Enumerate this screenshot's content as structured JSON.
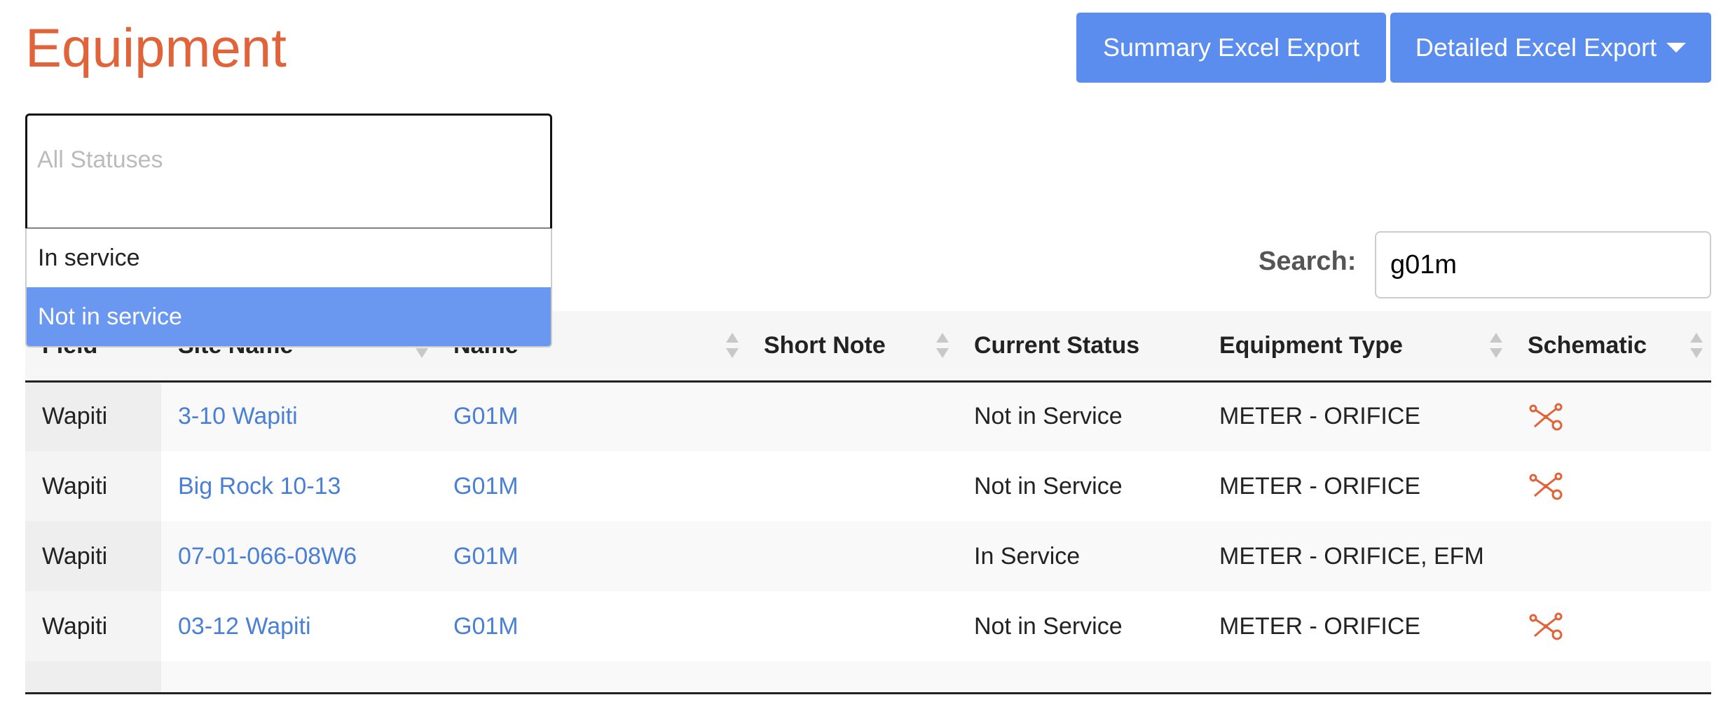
{
  "header": {
    "title": "Equipment",
    "summary_export_label": "Summary Excel Export",
    "detailed_export_label": "Detailed Excel Export"
  },
  "status_filter": {
    "placeholder": "All Statuses",
    "options": [
      "In service",
      "Not in service"
    ],
    "highlighted": "Not in service"
  },
  "search": {
    "label": "Search:",
    "value": "g01m"
  },
  "table": {
    "columns": [
      "Field",
      "Site Name",
      "Name",
      "Short Note",
      "Current Status",
      "Equipment Type",
      "Schematic"
    ],
    "rows": [
      {
        "field": "Wapiti",
        "site_name": "3-10 Wapiti",
        "name": "G01M",
        "short_note": "",
        "current_status": "Not in Service",
        "equipment_type": "METER - ORIFICE",
        "schematic_icon": "schematic-icon"
      },
      {
        "field": "Wapiti",
        "site_name": "Big Rock 10-13",
        "name": "G01M",
        "short_note": "",
        "current_status": "Not in Service",
        "equipment_type": "METER - ORIFICE",
        "schematic_icon": "schematic-icon"
      },
      {
        "field": "Wapiti",
        "site_name": "07-01-066-08W6",
        "name": "G01M",
        "short_note": "",
        "current_status": "In Service",
        "equipment_type": "METER - ORIFICE, EFM",
        "schematic_icon": ""
      },
      {
        "field": "Wapiti",
        "site_name": "03-12 Wapiti",
        "name": "G01M",
        "short_note": "",
        "current_status": "Not in Service",
        "equipment_type": "METER - ORIFICE",
        "schematic_icon": "schematic-icon"
      }
    ]
  },
  "colors": {
    "title": "#e0633a",
    "button": "#5b8def",
    "link": "#4a7fd6",
    "option_highlight": "#6a98f0",
    "schematic_icon": "#e0633a"
  }
}
